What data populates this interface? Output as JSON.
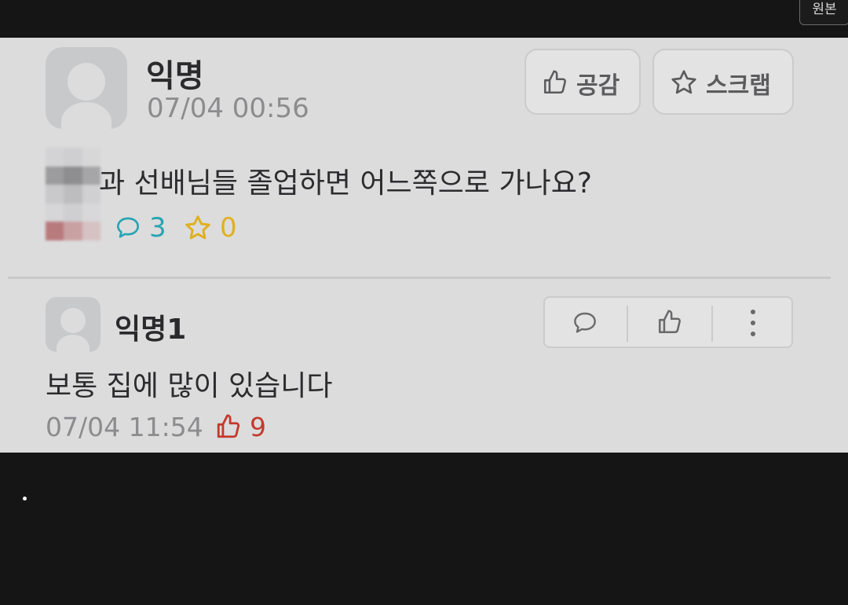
{
  "header": {
    "original_label": "원본"
  },
  "post": {
    "author": "익명",
    "time": "07/04 00:56",
    "like_button_label": "공감",
    "scrap_button_label": "스크랩",
    "title": "과 선배님들 졸업하면 어느쪽으로 가나요?",
    "comment_count": "3",
    "scrap_count": "0",
    "colors": {
      "comment": "#2aa4b2",
      "scrap": "#e0b020"
    }
  },
  "comment": {
    "author": "익명1",
    "text": "보통 집에 많이 있습니다",
    "time": "07/04 11:54",
    "like_count": "9",
    "colors": {
      "like": "#c23a2c"
    }
  }
}
